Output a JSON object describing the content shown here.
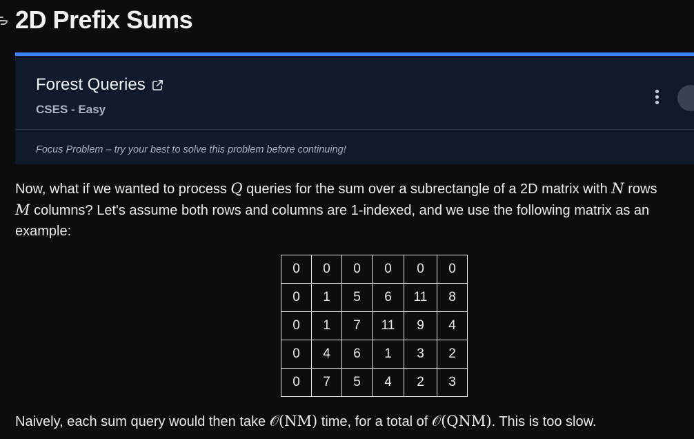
{
  "header": {
    "title": "2D Prefix Sums"
  },
  "focus_card": {
    "problem_name": "Forest Queries",
    "source": "CSES - Easy",
    "note": "Focus Problem – try your best to solve this problem before continuing!",
    "accent_color": "#3b82f6"
  },
  "intro": {
    "line1_a": "Now, what if we wanted to process ",
    "var_q": "Q",
    "line1_b": " queries for the sum over a subrectangle of a 2D matrix with ",
    "var_n": "N",
    "line1_c": " rows",
    "var_m": "M",
    "line2": " columns? Let's assume both rows and columns are 1-indexed, and we use the following matrix as an",
    "line3": "example:"
  },
  "matrix": [
    [
      "0",
      "0",
      "0",
      "0",
      "0",
      "0"
    ],
    [
      "0",
      "1",
      "5",
      "6",
      "11",
      "8"
    ],
    [
      "0",
      "1",
      "7",
      "11",
      "9",
      "4"
    ],
    [
      "0",
      "4",
      "6",
      "1",
      "3",
      "2"
    ],
    [
      "0",
      "7",
      "5",
      "4",
      "2",
      "3"
    ]
  ],
  "outro": {
    "text_a": "Naively, each sum query would then take ",
    "math_1": "𝒪(NM)",
    "text_b": " time, for a total of ",
    "math_2": "𝒪(QNM)",
    "text_c": ". This is too slow."
  }
}
